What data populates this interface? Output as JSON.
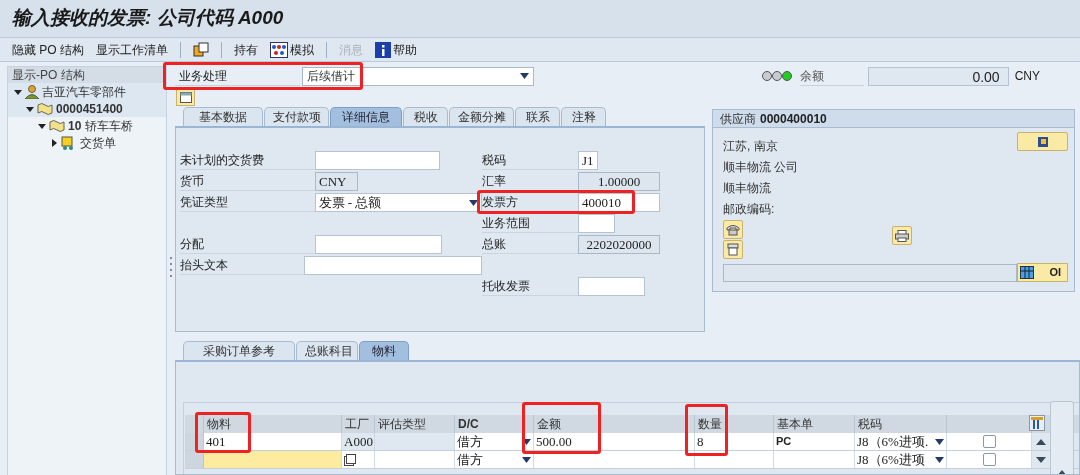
{
  "window": {
    "title": "输入接收的发票: 公司代码 A000"
  },
  "toolbar": [
    {
      "kind": "text",
      "label": "隐藏 PO 结构",
      "disabled": false
    },
    {
      "kind": "text",
      "label": "显示工作清单",
      "disabled": false
    },
    {
      "kind": "separator"
    },
    {
      "kind": "copy"
    },
    {
      "kind": "separator"
    },
    {
      "kind": "text",
      "label": "持有",
      "disabled": false
    },
    {
      "kind": "simulate",
      "label": "模拟",
      "disabled": false
    },
    {
      "kind": "separator"
    },
    {
      "kind": "text",
      "label": "消息",
      "disabled": true
    },
    {
      "kind": "help",
      "label": "帮助",
      "disabled": false
    }
  ],
  "po_tree": {
    "title": "显示-PO 结构",
    "items": [
      {
        "kind": "vendor",
        "label": "吉亚汽车零部件",
        "expanded": true,
        "children": [
          {
            "kind": "order",
            "label": "**0000451400**",
            "expanded": true,
            "children": [
              {
                "kind": "order",
                "label": "**10** 轿车车桥",
                "expanded": true,
                "children": [
                  {
                    "kind": "delivery",
                    "label": "交货单",
                    "expanded": false
                  }
                ]
              }
            ]
          }
        ]
      }
    ]
  },
  "transaction": {
    "label": "业务处理",
    "value": "后续借计"
  },
  "balance": {
    "label": "余额",
    "value": "0.00",
    "currency": "CNY"
  },
  "header_tabs": [
    {
      "label": "基本数据",
      "selected": false
    },
    {
      "label": "支付款项",
      "selected": false
    },
    {
      "label": "详细信息",
      "selected": true
    },
    {
      "label": "税收",
      "selected": false
    },
    {
      "label": "金额分摊",
      "selected": false
    },
    {
      "label": "联系",
      "selected": false
    },
    {
      "label": "注释",
      "selected": false
    }
  ],
  "detail_rows": [
    {
      "left": {
        "label": "未计划的交货费",
        "kind": "input"
      },
      "right": {
        "label": "税码",
        "kind": "input",
        "value": "J1"
      }
    },
    {
      "left": {
        "label": "货币",
        "kind": "readonly",
        "value": "CNY"
      },
      "right": {
        "label": "汇率",
        "kind": "readonly",
        "value": "1.00000"
      }
    },
    {
      "left": {
        "label": "凭证类型",
        "kind": "dropdown",
        "value": "发票 - 总额"
      },
      "right": {
        "label": "发票方",
        "kind": "input",
        "value": "400010"
      }
    },
    {
      "right": {
        "label": "业务范围",
        "kind": "input"
      }
    },
    {
      "left": {
        "label": "分配",
        "kind": "input"
      },
      "right": {
        "label": "总账",
        "kind": "readonly",
        "value": "2202020000"
      }
    },
    {
      "left": {
        "label": "抬头文本",
        "kind": "input"
      }
    },
    {
      "right": {
        "label": "托收发票",
        "kind": "input"
      }
    }
  ],
  "vendor": {
    "label": "供应商",
    "number": "0000400010",
    "lines": [
      "江苏, 南京",
      "顺丰物流 公司",
      "顺丰物流",
      "邮政编码:"
    ],
    "oi_button": "OI"
  },
  "item_tabs": [
    {
      "label": "采购订单参考",
      "selected": false
    },
    {
      "label": "总账科目",
      "selected": false
    },
    {
      "label": "物料",
      "selected": true
    }
  ],
  "table": {
    "columns": [
      "物料",
      "工厂",
      "评估类型",
      "D/C",
      "金额",
      "数量",
      "基本单",
      "税码",
      ""
    ],
    "rows": [
      {
        "active": false,
        "cells": [
          "401",
          "A000",
          "",
          "借方",
          "500.00",
          "8",
          "PC",
          "J8（6%进项.",
          ""
        ],
        "checked": false
      },
      {
        "active": true,
        "cells": [
          "",
          "",
          "",
          "借方",
          "",
          "",
          "",
          "J8（6%进项",
          ""
        ],
        "checked": false
      }
    ]
  }
}
